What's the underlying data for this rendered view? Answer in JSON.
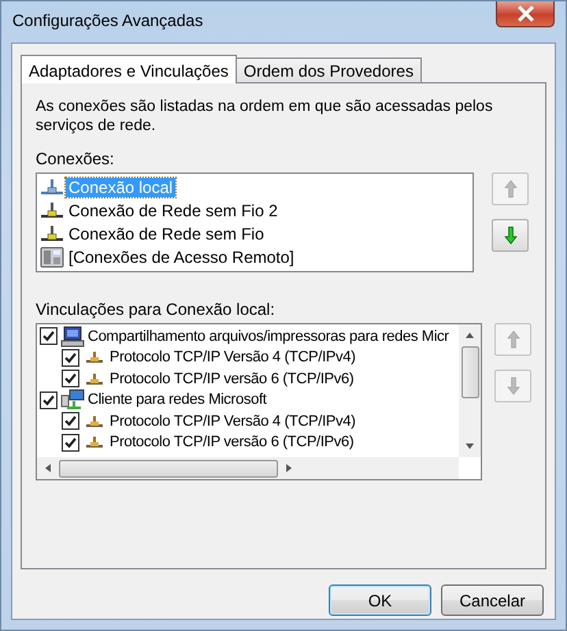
{
  "window": {
    "title": "Configurações Avançadas"
  },
  "tabs": [
    {
      "label": "Adaptadores e Vinculações",
      "selected": true
    },
    {
      "label": "Ordem dos Provedores",
      "selected": false
    }
  ],
  "description": "As conexões são listadas na ordem em que são acessadas pelos serviços de rede.",
  "connections": {
    "label": "Conexões:",
    "items": [
      {
        "label": "Conexão local",
        "kind": "lan",
        "selected": true
      },
      {
        "label": "Conexão de Rede sem Fio 2",
        "kind": "wireless",
        "selected": false
      },
      {
        "label": "Conexão de Rede sem Fio",
        "kind": "wireless",
        "selected": false
      },
      {
        "label": "[Conexões de Acesso Remoto]",
        "kind": "remote",
        "selected": false
      }
    ],
    "up_disabled": true,
    "down_disabled": false
  },
  "bindings": {
    "label": "Vinculações para Conexão local:",
    "items": [
      {
        "label": "Compartilhamento arquivos/impressoras para redes Micr",
        "kind": "computer",
        "checked": true,
        "children": [
          {
            "label": "Protocolo TCP/IP Versão 4 (TCP/IPv4)",
            "kind": "protocol",
            "checked": true
          },
          {
            "label": "Protocolo TCP/IP versão 6 (TCP/IPv6)",
            "kind": "protocol",
            "checked": true
          }
        ]
      },
      {
        "label": "Cliente para redes Microsoft",
        "kind": "client",
        "checked": true,
        "children": [
          {
            "label": "Protocolo TCP/IP Versão 4 (TCP/IPv4)",
            "kind": "protocol",
            "checked": true
          },
          {
            "label": "Protocolo TCP/IP versão 6 (TCP/IPv6)",
            "kind": "protocol",
            "checked": true
          }
        ]
      }
    ],
    "up_disabled": true,
    "down_disabled": true
  },
  "buttons": [
    "OK",
    "Cancelar"
  ]
}
